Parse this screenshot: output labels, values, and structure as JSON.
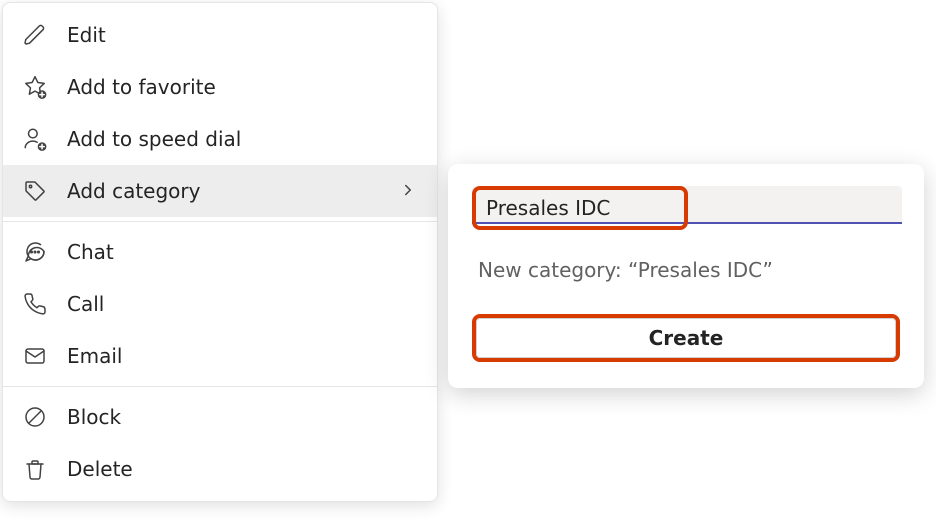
{
  "menu": {
    "items": [
      {
        "label": "Edit"
      },
      {
        "label": "Add to favorite"
      },
      {
        "label": "Add to speed dial"
      },
      {
        "label": "Add category"
      },
      {
        "label": "Chat"
      },
      {
        "label": "Call"
      },
      {
        "label": "Email"
      },
      {
        "label": "Block"
      },
      {
        "label": "Delete"
      }
    ]
  },
  "popover": {
    "input_value": "Presales IDC",
    "hint": "New category: “Presales IDC”",
    "create_label": "Create"
  },
  "highlight_color": "#d83b01",
  "accent_color": "#4f52b2"
}
